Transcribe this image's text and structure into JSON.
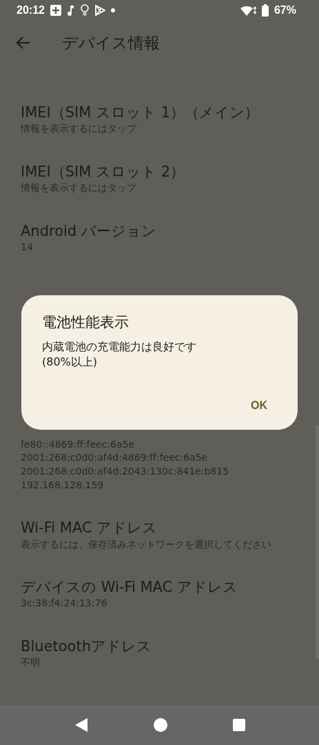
{
  "status_bar": {
    "time": "20:12",
    "battery_percent": "67%"
  },
  "app_bar": {
    "title": "デバイス情報"
  },
  "items": [
    {
      "title": "IMEI（SIM スロット 1）（メイン）",
      "subtitle_lines": [
        "情報を表示するにはタップ"
      ]
    },
    {
      "title": "IMEI（SIM スロット 2）",
      "subtitle_lines": [
        "情報を表示するにはタップ"
      ]
    },
    {
      "title": "Android バージョン",
      "subtitle_lines": [
        "14"
      ]
    },
    {
      "subtitle_lines": [
        "fe80::4869:ff:feec:6a5e",
        "2001:268:c0d0:af4d:4869:ff:feec:6a5e",
        "2001:268:c0d0:af4d:2043:130c:841e:b815",
        "192.168.128.159"
      ]
    },
    {
      "title": "Wi-Fi MAC アドレス",
      "subtitle_lines": [
        "表示するには、保存済みネットワークを選択してください"
      ]
    },
    {
      "title": "デバイスの Wi-Fi MAC アドレス",
      "subtitle_lines": [
        "3c:38:f4:24:13:76"
      ]
    },
    {
      "title": "Bluetoothアドレス",
      "subtitle_lines": [
        "不明"
      ]
    }
  ],
  "dialog": {
    "title": "電池性能表示",
    "message_lines": [
      "内蔵電池の充電能力は良好です",
      "(80%以上)"
    ],
    "button": "OK"
  }
}
